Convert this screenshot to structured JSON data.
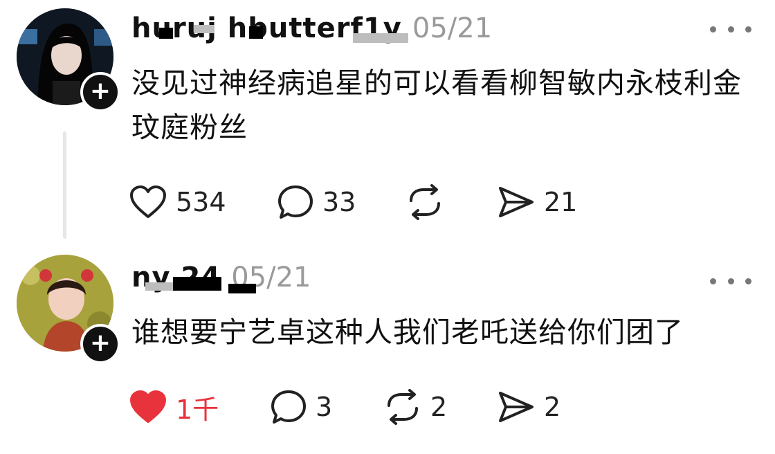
{
  "posts": [
    {
      "username": "huruj hbutterf1y",
      "date": "05/21",
      "content": "没见过神经病追星的可以看看柳智敏内永枝利金玟庭粉丝",
      "likes": "534",
      "comments": "33",
      "reposts": "",
      "shares": "21",
      "liked": false
    },
    {
      "username": "ny 24",
      "date": "05/21",
      "content": "谁想要宁艺卓这种人我们老吒送给你们团了",
      "likes": "1千",
      "comments": "3",
      "reposts": "2",
      "shares": "2",
      "liked": true
    }
  ],
  "ui": {
    "follow_symbol": "+",
    "like_color": "#e8333c"
  }
}
